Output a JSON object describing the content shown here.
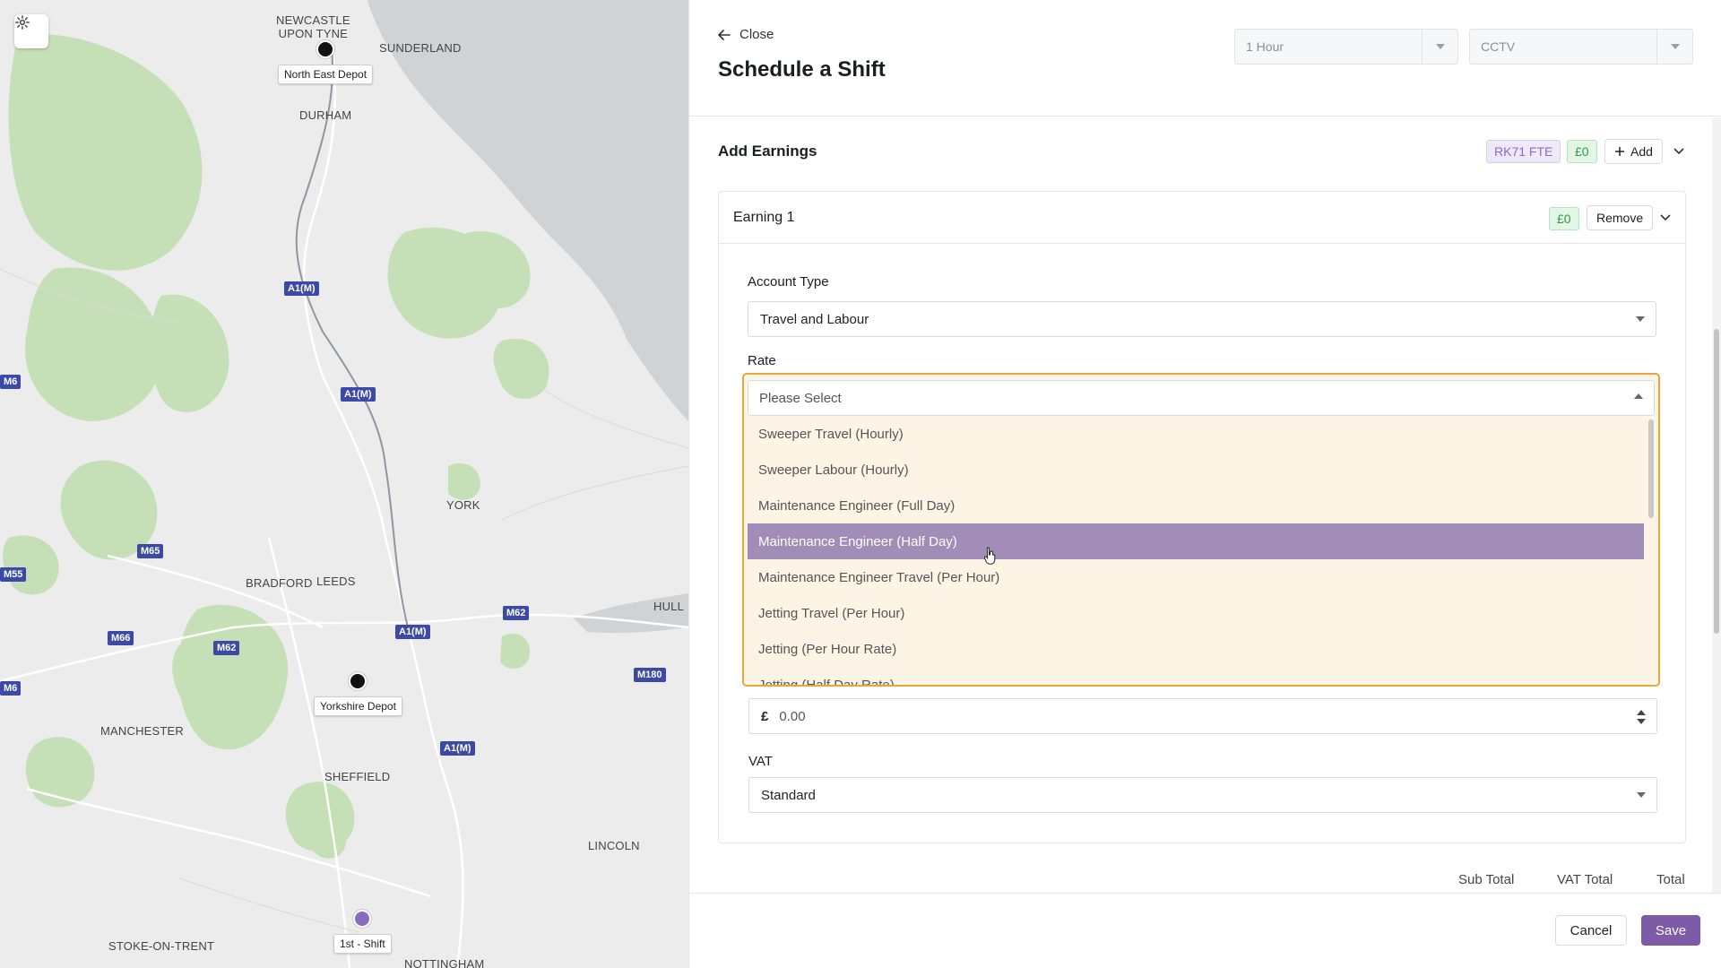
{
  "map": {
    "settings_icon": "gear-icon",
    "cities": [
      {
        "id": "newcastle",
        "label": "NEWCASTLE\nUPON TYNE"
      },
      {
        "id": "sunderland",
        "label": "SUNDERLAND"
      },
      {
        "id": "durham",
        "label": "DURHAM"
      },
      {
        "id": "york",
        "label": "YORK"
      },
      {
        "id": "bradford",
        "label": "BRADFORD"
      },
      {
        "id": "leeds",
        "label": "LEEDS"
      },
      {
        "id": "hull",
        "label": "HULL"
      },
      {
        "id": "manchester",
        "label": "MANCHESTER"
      },
      {
        "id": "sheffield",
        "label": "SHEFFIELD"
      },
      {
        "id": "lincoln",
        "label": "LINCOLN"
      },
      {
        "id": "stoke",
        "label": "STOKE-ON-TRENT"
      },
      {
        "id": "nottingham",
        "label": "NOTTINGHAM"
      }
    ],
    "roads": [
      "A1(M)",
      "A1(M)",
      "M6",
      "M65",
      "M55",
      "M66",
      "M62",
      "M62",
      "M6",
      "A1(M)",
      "A1(M)",
      "M180"
    ],
    "markers": {
      "north_east": "North East Depot",
      "yorkshire": "Yorkshire Depot",
      "shift": "1st - Shift"
    }
  },
  "header": {
    "close_label": "Close",
    "title": "Schedule a Shift",
    "duration_select": "1 Hour",
    "category_select": "CCTV"
  },
  "earnings": {
    "section_title": "Add Earnings",
    "tag": "RK71 FTE",
    "total_badge": "£0",
    "add_label": "Add",
    "card": {
      "title": "Earning 1",
      "badge": "£0",
      "remove_label": "Remove",
      "account_type_label": "Account Type",
      "account_type_value": "Travel and Labour",
      "rate_label": "Rate",
      "rate_placeholder": "Please Select",
      "rate_options": [
        "Sweeper Travel (Hourly)",
        "Sweeper Labour (Hourly)",
        "Maintenance Engineer (Full Day)",
        "Maintenance Engineer (Half Day)",
        "Maintenance Engineer Travel (Per Hour)",
        "Jetting Travel (Per Hour)",
        "Jetting (Per Hour Rate)",
        "Jetting (Half Day Rate)"
      ],
      "highlighted_option_index": 3,
      "unit_currency": "£",
      "unit_amount": "0.00",
      "vat_label": "VAT",
      "vat_value": "Standard"
    },
    "totals": {
      "sub_total_label": "Sub Total",
      "vat_total_label": "VAT Total",
      "total_label": "Total"
    }
  },
  "footer": {
    "cancel_label": "Cancel",
    "save_label": "Save"
  },
  "colors": {
    "accent": "#7d5ba6",
    "highlight": "#a28db9",
    "focus_border": "#e8a63b",
    "dropdown_bg": "#fdf4e6",
    "success": "#2e9b47"
  }
}
